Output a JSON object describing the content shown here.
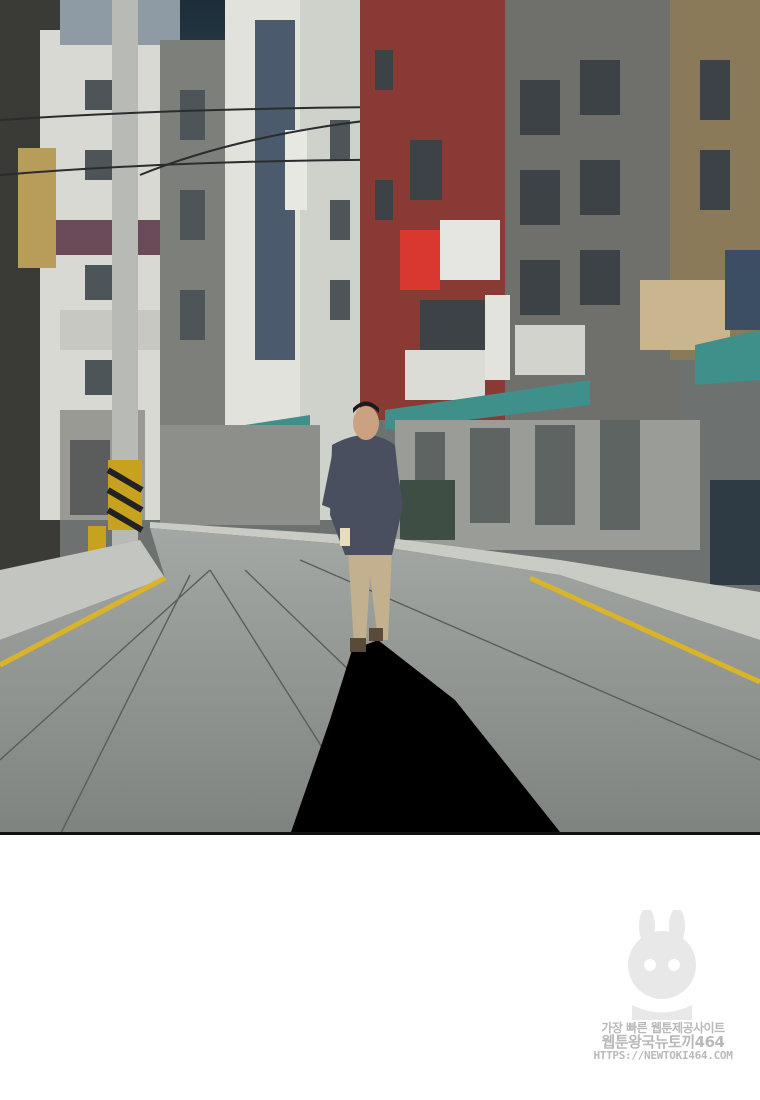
{
  "watermark": {
    "line1": "가장 빠른 웹툰제공사이트",
    "line2": "웹툰왕국뉴토끼464",
    "line3": "HTTPS://NEWTOKI464.COM"
  },
  "colors": {
    "road": "#8d918e",
    "lane_yellow": "#d9b429",
    "awning_teal": "#3f8f8a",
    "red_building": "#8a3a34",
    "sky": "#1f3340",
    "shadow": "#000000"
  }
}
